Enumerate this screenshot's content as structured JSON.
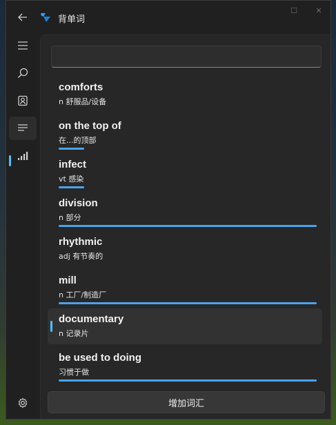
{
  "app": {
    "title": "背单词",
    "accent_color": "#4cc2ff",
    "progress_color": "#4ba3ee"
  },
  "nav": {
    "items": [
      {
        "icon": "hamburger-menu-icon",
        "active": false
      },
      {
        "icon": "search-icon",
        "active": false
      },
      {
        "icon": "person-card-icon",
        "active": false
      },
      {
        "icon": "word-list-icon",
        "active": true
      },
      {
        "icon": "signal-bars-icon",
        "active": false
      }
    ],
    "footer_icon": "gear-icon"
  },
  "search": {
    "value": "",
    "placeholder": ""
  },
  "words": [
    {
      "term": "comforts",
      "definition": "n 舒服品/设备",
      "progress": 0,
      "selected": false
    },
    {
      "term": "on the top of",
      "definition": " 在...的顶部",
      "progress": 0.1,
      "selected": false
    },
    {
      "term": "infect",
      "definition": "vt 感染",
      "progress": 0.1,
      "selected": false
    },
    {
      "term": "division",
      "definition": "n 部分",
      "progress": 1,
      "selected": false
    },
    {
      "term": "rhythmic",
      "definition": "adj 有节奏的",
      "progress": 0,
      "selected": false
    },
    {
      "term": "mill",
      "definition": "n 工厂/制造厂",
      "progress": 1,
      "selected": false
    },
    {
      "term": "documentary",
      "definition": "n 记录片",
      "progress": 0,
      "selected": true
    },
    {
      "term": "be used to doing",
      "definition": " 习惯于做",
      "progress": 1,
      "selected": false
    }
  ],
  "add_button": {
    "label": "增加词汇"
  }
}
